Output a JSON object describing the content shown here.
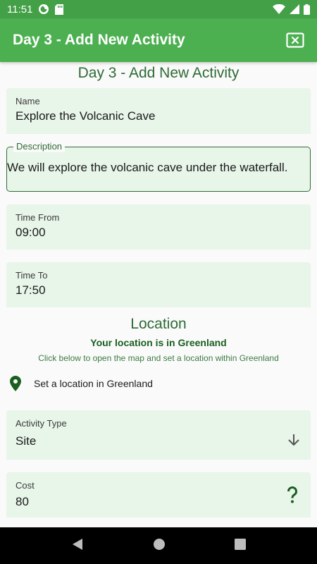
{
  "status_bar": {
    "time": "11:51"
  },
  "app_bar": {
    "title": "Day 3 - Add New Activity"
  },
  "page": {
    "title": "Day 3 - Add New Activity"
  },
  "fields": {
    "name": {
      "label": "Name",
      "value": "Explore the Volcanic Cave"
    },
    "description": {
      "label": "Description",
      "value": "We will explore the volcanic cave under the waterfall."
    },
    "time_from": {
      "label": "Time From",
      "value": "09:00"
    },
    "time_to": {
      "label": "Time To",
      "value": "17:50"
    },
    "activity_type": {
      "label": "Activity Type",
      "value": "Site"
    },
    "cost": {
      "label": "Cost",
      "value": "80"
    }
  },
  "location": {
    "heading": "Location",
    "status": "Your location is in Greenland",
    "hint": "Click below to open the map and set a location within Greenland",
    "set_label": "Set a location in Greenland"
  },
  "colors": {
    "status_bar": "#43a047",
    "app_bar": "#4caf50",
    "field_bg": "#e8f5e9",
    "accent_dark": "#1b5e20"
  },
  "icons": {
    "close": "close-box-icon",
    "location": "map-pin-icon",
    "dropdown": "arrow-down-icon",
    "cost_help": "question-mark-icon"
  }
}
